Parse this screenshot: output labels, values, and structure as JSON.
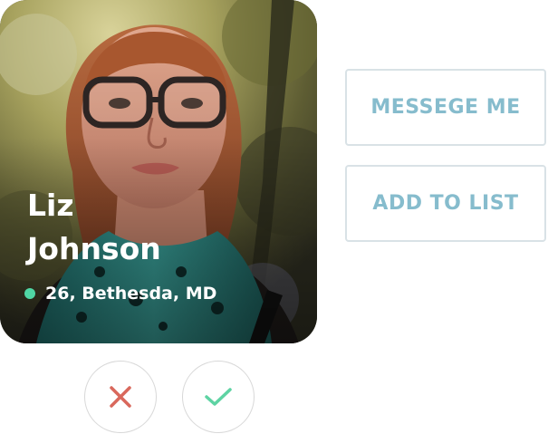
{
  "profile": {
    "first_name": "Liz",
    "last_name": "Johnson",
    "details": "26, Bethesda, MD",
    "online": true,
    "online_color": "#4fd6a4"
  },
  "actions": {
    "message_label": "MESSEGE ME",
    "add_to_list_label": "ADD TO LIST"
  },
  "swipe": {
    "reject_icon": "close-icon",
    "reject_color": "#d9685c",
    "accept_icon": "check-icon",
    "accept_color": "#5ed3a3"
  },
  "colors": {
    "button_text": "#86bccd",
    "button_border": "#d9e2e6"
  }
}
